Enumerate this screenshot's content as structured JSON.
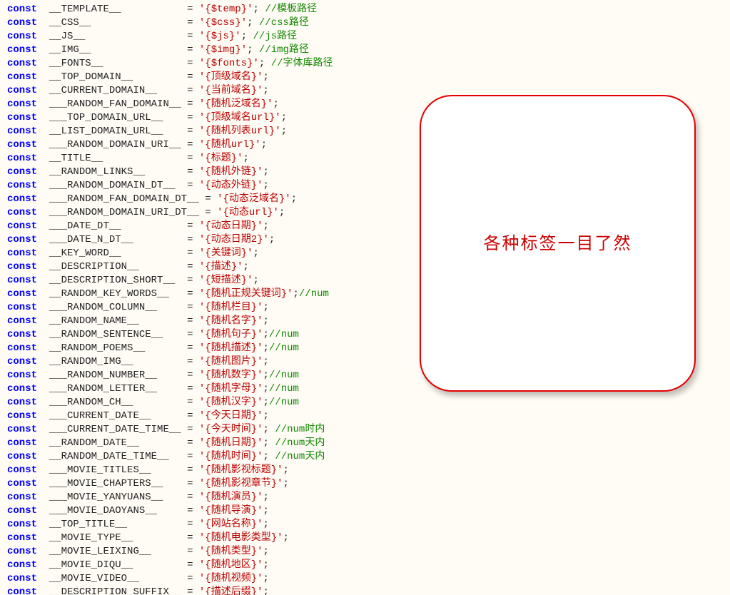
{
  "callout": {
    "text": "各种标签一目了然"
  },
  "lines": [
    {
      "name": "__TEMPLATE__",
      "value": "'{$temp}'",
      "tail": "; ",
      "comment": "//模板路径"
    },
    {
      "name": "__CSS__",
      "value": "'{$css}'",
      "tail": "; ",
      "comment": "//css路径"
    },
    {
      "name": "__JS__",
      "value": "'{$js}'",
      "tail": "; ",
      "comment": "//js路径"
    },
    {
      "name": "__IMG__",
      "value": "'{$img}'",
      "tail": "; ",
      "comment": "//img路径"
    },
    {
      "name": "__FONTS__",
      "value": "'{$fonts}'",
      "tail": "; ",
      "comment": "//字体库路径"
    },
    {
      "name": "__TOP_DOMAIN__",
      "value": "'{顶级域名}'",
      "tail": ";"
    },
    {
      "name": "__CURRENT_DOMAIN__",
      "value": "'{当前域名}'",
      "tail": ";"
    },
    {
      "name": "___RANDOM_FAN_DOMAIN__",
      "value": "'{随机泛域名}'",
      "tail": ";"
    },
    {
      "name": "___TOP_DOMAIN_URL__",
      "value": "'{顶级域名url}'",
      "tail": ";"
    },
    {
      "name": "__LIST_DOMAIN_URL__",
      "value": "'{随机列表url}'",
      "tail": ";"
    },
    {
      "name": "___RANDOM_DOMAIN_URI__",
      "value": "'{随机url}'",
      "tail": ";"
    },
    {
      "name": "__TITLE__",
      "value": "'{标题}'",
      "tail": ";"
    },
    {
      "name": "__RANDOM_LINKS__",
      "value": "'{随机外链}'",
      "tail": ";"
    },
    {
      "name": "___RANDOM_DOMAIN_DT__",
      "value": "'{动态外链}'",
      "tail": ";"
    },
    {
      "name": "___RANDOM_FAN_DOMAIN_DT__",
      "value": "'{动态泛域名}'",
      "tail": ";"
    },
    {
      "name": "___RANDOM_DOMAIN_URI_DT__",
      "value": "'{动态url}'",
      "tail": ";"
    },
    {
      "name": "___DATE_DT__",
      "value": "'{动态日期}'",
      "tail": ";"
    },
    {
      "name": "___DATE_N_DT__",
      "value": "'{动态日期2}'",
      "tail": ";"
    },
    {
      "name": "__KEY_WORD__",
      "value": "'{关键词}'",
      "tail": ";"
    },
    {
      "name": "__DESCRIPTION__",
      "value": "'{描述}'",
      "tail": ";"
    },
    {
      "name": "__DESCRIPTION_SHORT__",
      "value": "'{短描述}'",
      "tail": ";"
    },
    {
      "name": "__RANDOM_KEY_WORDS__",
      "value": "'{随机正规关键词}'",
      "tail": ";",
      "comment": "//num"
    },
    {
      "name": "___RANDOM_COLUMN__",
      "value": "'{随机栏目}'",
      "tail": ";"
    },
    {
      "name": "__RANDOM_NAME__",
      "value": "'{随机名字}'",
      "tail": ";"
    },
    {
      "name": "__RANDOM_SENTENCE__",
      "value": "'{随机句子}'",
      "tail": ";",
      "comment": "//num"
    },
    {
      "name": "__RANDOM_POEMS__",
      "value": "'{随机描述}'",
      "tail": ";",
      "comment": "//num"
    },
    {
      "name": "__RANDOM_IMG__",
      "value": "'{随机图片}'",
      "tail": ";"
    },
    {
      "name": "___RANDOM_NUMBER__",
      "value": "'{随机数字}'",
      "tail": ";",
      "comment": "//num"
    },
    {
      "name": "___RANDOM_LETTER__",
      "value": "'{随机字母}'",
      "tail": ";",
      "comment": "//num"
    },
    {
      "name": "___RANDOM_CH__",
      "value": "'{随机汉字}'",
      "tail": ";",
      "comment": "//num"
    },
    {
      "name": "___CURRENT_DATE__",
      "value": "'{今天日期}'",
      "tail": ";"
    },
    {
      "name": "___CURRENT_DATE_TIME__",
      "value": "'{今天时间}'",
      "tail": "; ",
      "comment": "//num时内"
    },
    {
      "name": "__RANDOM_DATE__",
      "value": "'{随机日期}'",
      "tail": "; ",
      "comment": "//num天内"
    },
    {
      "name": "__RANDOM_DATE_TIME__",
      "value": "'{随机时间}'",
      "tail": "; ",
      "comment": "//num天内"
    },
    {
      "name": "___MOVIE_TITLES__",
      "value": "'{随机影视标题}'",
      "tail": ";"
    },
    {
      "name": "___MOVIE_CHAPTERS__",
      "value": "'{随机影视章节}'",
      "tail": ";"
    },
    {
      "name": "___MOVIE_YANYUANS__",
      "value": "'{随机演员}'",
      "tail": ";"
    },
    {
      "name": "___MOVIE_DAOYANS__",
      "value": "'{随机导演}'",
      "tail": ";"
    },
    {
      "name": "__TOP_TITLE__",
      "value": "'{网站名称}'",
      "tail": ";"
    },
    {
      "name": "__MOVIE_TYPE__",
      "value": "'{随机电影类型}'",
      "tail": ";"
    },
    {
      "name": "__MOVIE_LEIXING__",
      "value": "'{随机类型}'",
      "tail": ";"
    },
    {
      "name": "__MOVIE_DIQU__",
      "value": "'{随机地区}'",
      "tail": ";"
    },
    {
      "name": "__MOVIE_VIDEO__",
      "value": "'{随机视频}'",
      "tail": ";"
    },
    {
      "name": "__DESCRIPTION_SUFFIX__",
      "value": "'{描述后缀}'",
      "tail": ";"
    }
  ]
}
